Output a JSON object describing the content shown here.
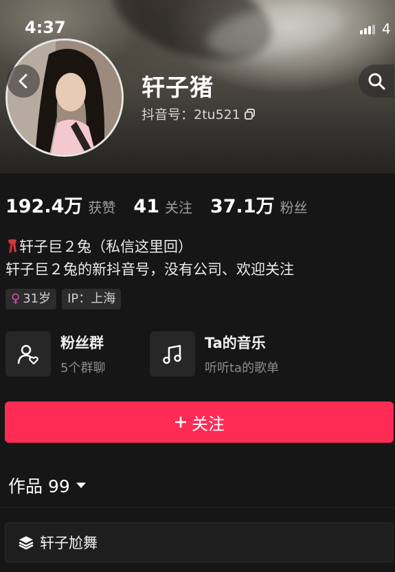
{
  "status_bar": {
    "time": "4:37",
    "battery_digit": "4"
  },
  "profile": {
    "nickname": "轩子猪",
    "account_id": "抖音号：2tu521"
  },
  "stats": [
    {
      "value": "192.4万",
      "label": "获赞"
    },
    {
      "value": "41",
      "label": "关注"
    },
    {
      "value": "37.1万",
      "label": "粉丝"
    }
  ],
  "bio": {
    "line1": "轩子巨２兔（私信这里回）",
    "line2": "轩子巨２兔的新抖音号，没有公司、欢迎关注"
  },
  "tags": {
    "age": "31岁",
    "ip": "IP：上海"
  },
  "cards": [
    {
      "title": "粉丝群",
      "subtitle": "5个群聊",
      "icon": "fan-group-icon"
    },
    {
      "title": "Ta的音乐",
      "subtitle": "听听ta的歌单",
      "icon": "music-note-icon"
    }
  ],
  "follow_button": {
    "label": "关注"
  },
  "works": {
    "label": "作品 99"
  },
  "collection": {
    "label": "轩子尬舞"
  },
  "colors": {
    "accent": "#fe2c55",
    "background": "#161616",
    "muted_text": "#9d9d9d",
    "female_icon": "#e34ab5"
  }
}
